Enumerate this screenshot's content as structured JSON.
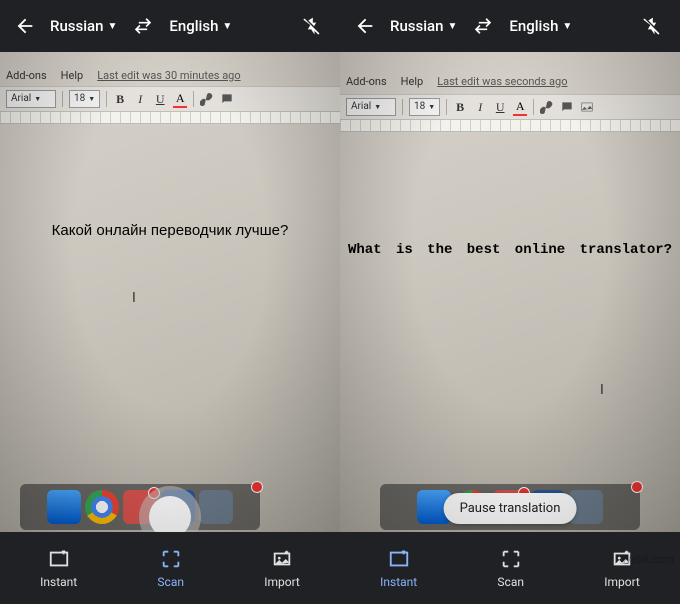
{
  "left": {
    "topbar": {
      "source_lang": "Russian",
      "target_lang": "English"
    },
    "docmenu": {
      "addons": "Add-ons",
      "help": "Help",
      "lastedit": "Last edit was 30 minutes ago"
    },
    "toolbar": {
      "font": "Arial",
      "size": "18",
      "bold": "B",
      "italic": "I",
      "underline": "U",
      "colorA": "A"
    },
    "doctext": "Какой онлайн переводчик лучше?",
    "nav": {
      "instant": "Instant",
      "scan": "Scan",
      "import": "Import",
      "active": "scan"
    }
  },
  "right": {
    "topbar": {
      "source_lang": "Russian",
      "target_lang": "English"
    },
    "docmenu": {
      "addons": "Add-ons",
      "help": "Help",
      "lastedit": "Last edit was seconds ago"
    },
    "toolbar": {
      "font": "Arial",
      "size": "18",
      "bold": "B",
      "italic": "I",
      "underline": "U",
      "colorA": "A"
    },
    "doctext": "What is the best online translator?",
    "pause_label": "Pause translation",
    "nav": {
      "instant": "Instant",
      "scan": "Scan",
      "import": "Import",
      "active": "instant"
    }
  },
  "watermark": "Webit.com"
}
